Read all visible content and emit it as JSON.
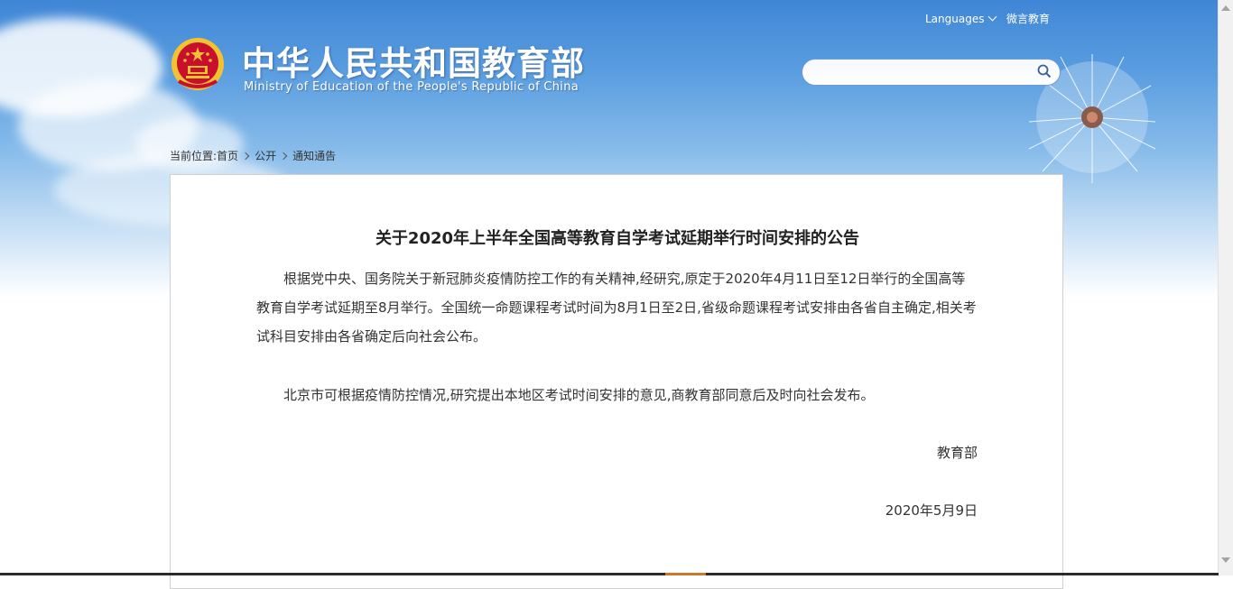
{
  "header": {
    "title_cn": "中华人民共和国教育部",
    "title_en": "Ministry of Education of the People's Republic of China",
    "languages_label": "Languages",
    "wechat_label": "微言教育",
    "search": {
      "value": "",
      "placeholder": ""
    }
  },
  "breadcrumb": {
    "prefix": "当前位置:",
    "items": [
      "首页",
      "公开",
      "通知通告"
    ]
  },
  "article": {
    "title": "关于2020年上半年全国高等教育自学考试延期举行时间安排的公告",
    "paragraphs": [
      "根据党中央、国务院关于新冠肺炎疫情防控工作的有关精神,经研究,原定于2020年4月11日至12日举行的全国高等教育自学考试延期至8月举行。全国统一命题课程考试时间为8月1日至2日,省级命题课程考试安排由各省自主确定,相关考试科目安排由各省确定后向社会公布。",
      "北京市可根据疫情防控情况,研究提出本地区考试时间安排的意见,商教育部同意后及时向社会发布。"
    ],
    "signature_org": "教育部",
    "signature_date": "2020年5月9日"
  },
  "colors": {
    "sky_top": "#3f86d6",
    "search_border": "#6f9ad6",
    "emblem_red": "#c8102e",
    "emblem_gold": "#f2c230"
  },
  "icons": {
    "search": "search-icon",
    "emblem": "national-emblem-icon",
    "chevron": "chevron-down-icon"
  }
}
